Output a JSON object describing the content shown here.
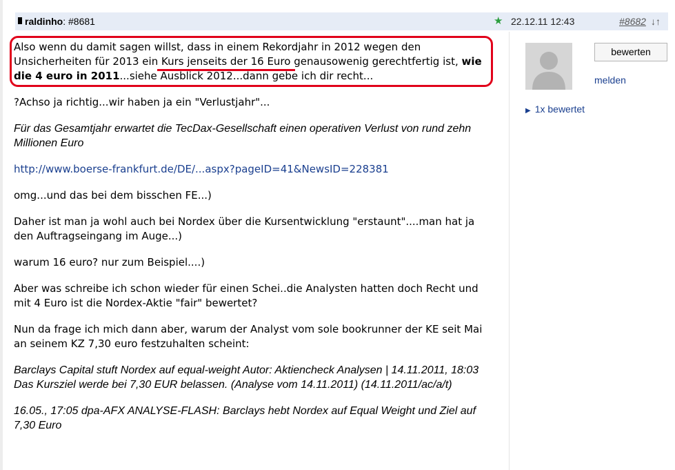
{
  "header": {
    "author": "raldinho",
    "post_id": ": #8681",
    "date": "22.12.11 12:43",
    "next_post": "#8682",
    "arrows": "↓↑"
  },
  "post": {
    "para1_a": "Also wenn du damit sagen willst, dass in einem Rekordjahr in 2012 wegen den Unsicherheiten für 2013 ein ",
    "para1_underlined": "Kurs jenseits der 16 Euro",
    "para1_b": " genausowenig gerechtfertig ist, ",
    "para1_bold": "wie die 4 euro in 2011",
    "para1_c": "...siehe Ausblick 2012...dann gebe ich dir recht...",
    "para2": "?Achso ja richtig...wir haben ja ein \"Verlustjahr\"...",
    "quote1": "Für das Gesamtjahr erwartet die TecDax-Gesellschaft einen operativen Verlust von rund zehn Millionen Euro",
    "link": "http://www.boerse-frankfurt.de/DE/...aspx?pageID=41&NewsID=228381",
    "para3": "omg...und das bei dem bisschen FE...)",
    "para4": "Daher ist man ja wohl auch bei Nordex  über die Kursentwicklung \"erstaunt\"....man hat ja den Auftragseingang im Auge...)",
    "para5": "warum 16 euro? nur zum Beispiel....)",
    "para6": "Aber was schreibe ich schon wieder für einen Schei..die Analysten hatten doch Recht und mit 4 Euro ist die Nordex-Aktie \"fair\" bewertet?",
    "para7": "Nun da frage  ich mich dann aber, warum der Analyst vom sole bookrunner der KE seit Mai an seinem KZ 7,30 euro festzuhalten scheint:",
    "quote2_line1": "Barclays Capital stuft Nordex auf equal-weight Autor: Aktiencheck Analysen  |  14.11.2011, 18:03",
    "quote2_line2": "Das Kursziel werde bei 7,30 EUR belassen. (Analyse vom 14.11.2011) (14.11.2011/ac/a/t)",
    "quote3": "16.05., 17:05 dpa-AFX ANALYSE-FLASH: Barclays hebt Nordex auf Equal Weight und Ziel auf 7,30 Euro"
  },
  "sidebar": {
    "rate_button": "bewerten",
    "report_link": "melden",
    "rated_count": "1x bewertet"
  },
  "colors": {
    "accent_red": "#e1001a",
    "link_blue": "#1a3f8f",
    "header_bg": "#e6ecf6",
    "star_green": "#2a9d3c"
  }
}
